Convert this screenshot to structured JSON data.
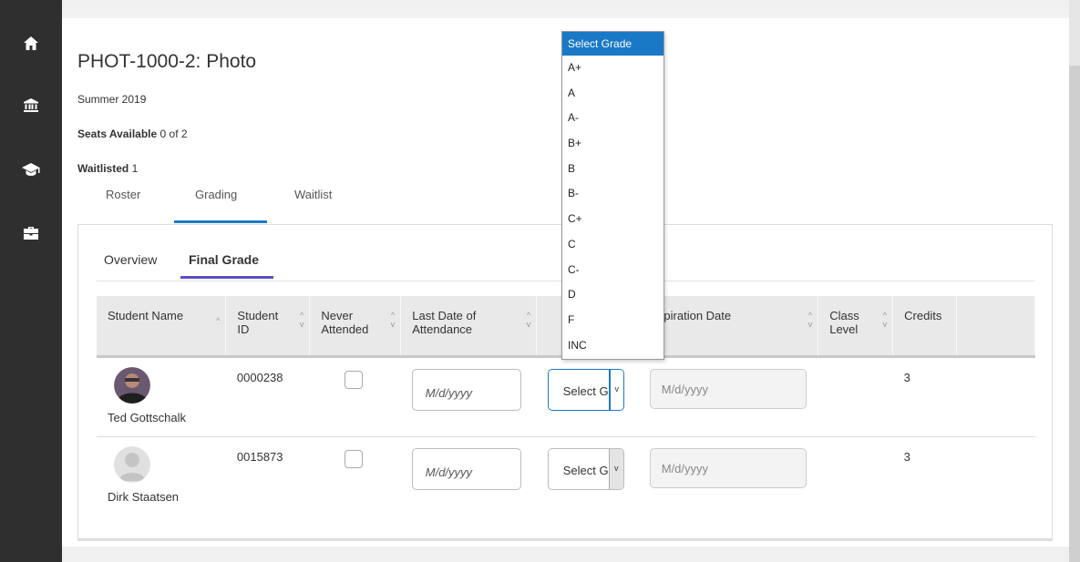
{
  "course": {
    "title": "PHOT-1000-2: Photo",
    "term": "Summer 2019",
    "seats_label": "Seats Available",
    "seats_value": "0 of 2",
    "waitlisted_label": "Waitlisted",
    "waitlisted_value": "1"
  },
  "tabs": [
    {
      "label": "Roster",
      "active": false
    },
    {
      "label": "Grading",
      "active": true
    },
    {
      "label": "Waitlist",
      "active": false
    }
  ],
  "subtabs": [
    {
      "label": "Overview",
      "active": false
    },
    {
      "label": "Final Grade",
      "active": true
    }
  ],
  "table": {
    "headers": {
      "student_name": "Student Name",
      "student_id_1": "Student",
      "student_id_2": "ID",
      "never_attended_1": "Never",
      "never_attended_2": "Attended",
      "last_date_1": "Last Date of",
      "last_date_2": "Attendance",
      "expiration_date": "Expiration Date",
      "class_level_1": "Class",
      "class_level_2": "Level",
      "credits": "Credits"
    },
    "rows": [
      {
        "name": "Ted Gottschalk",
        "id": "0000238",
        "date_placeholder": "M/d/yyyy",
        "grade": "Select Grade",
        "expiration_placeholder": "M/d/yyyy",
        "credits": "3"
      },
      {
        "name": "Dirk Staatsen",
        "id": "0015873",
        "date_placeholder": "M/d/yyyy",
        "grade": "Select Grade",
        "expiration_placeholder": "M/d/yyyy",
        "credits": "3"
      }
    ]
  },
  "grade_options": [
    "Select Grade",
    "A+",
    "A",
    "A-",
    "B+",
    "B",
    "B-",
    "C+",
    "C",
    "C-",
    "D",
    "F",
    "INC"
  ],
  "colors": {
    "sidebar": "#2f2f2f",
    "accent_blue": "#1a79c6",
    "accent_purple": "#5b4fc7"
  },
  "icons": {
    "sidebar": [
      "home-icon",
      "institution-icon",
      "graduation-cap-icon",
      "briefcase-icon"
    ]
  }
}
